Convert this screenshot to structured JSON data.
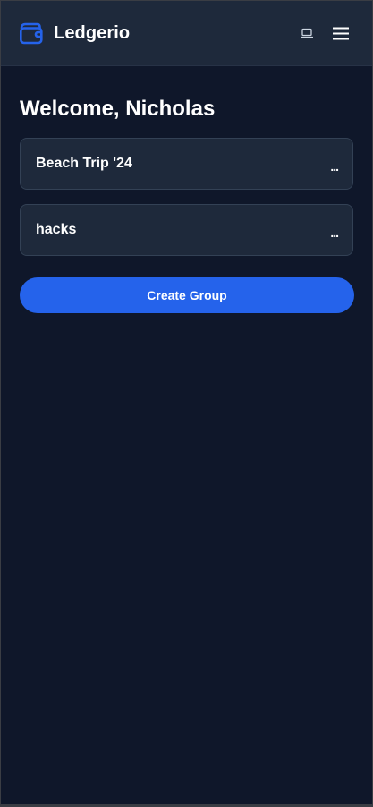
{
  "app": {
    "name": "Ledgerio",
    "logo_icon": "wallet-icon",
    "accent_color": "#2563eb"
  },
  "header": {
    "actions": [
      {
        "icon": "laptop-icon"
      },
      {
        "icon": "hamburger-menu-icon"
      }
    ]
  },
  "main": {
    "title": "Welcome, Nicholas",
    "groups": [
      {
        "name": "Beach Trip '24",
        "menu_label": "..."
      },
      {
        "name": "hacks",
        "menu_label": "..."
      }
    ],
    "create_button_label": "Create Group"
  },
  "colors": {
    "background": "#0f172a",
    "card": "#1e293b",
    "card_border": "#334155",
    "primary": "#2563eb"
  }
}
